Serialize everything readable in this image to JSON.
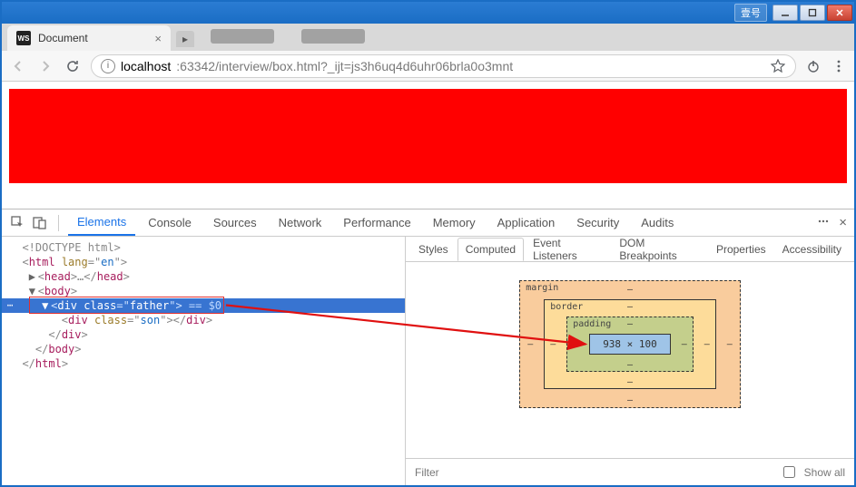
{
  "window": {
    "lang_badge": "壹号"
  },
  "tab": {
    "title": "Document",
    "favicon": "WS"
  },
  "address": {
    "host": "localhost",
    "path": ":63342/interview/box.html?_ijt=js3h6uq4d6uhr06brla0o3mnt"
  },
  "devtools": {
    "tabs": [
      "Elements",
      "Console",
      "Sources",
      "Network",
      "Performance",
      "Memory",
      "Application",
      "Security",
      "Audits"
    ],
    "active_tab": 0,
    "dom": {
      "l0": "<!DOCTYPE html>",
      "l1_open": "<",
      "l1_tag": "html",
      "l1_attr": " lang",
      "l1_eq": "=\"",
      "l1_val": "en",
      "l1_close": "\">",
      "l2_open": "<",
      "l2_tag": "head",
      "l2_mid": ">…</",
      "l2_tag2": "head",
      "l2_end": ">",
      "l3_open": "<",
      "l3_tag": "body",
      "l3_end": ">",
      "sel_open": "<",
      "sel_tag": "div",
      "sel_attr": " class",
      "sel_eq": "=\"",
      "sel_val": "father",
      "sel_close": "\">",
      "sel_suffix": " == $0",
      "l5_open": "<",
      "l5_tag": "div",
      "l5_attr": " class",
      "l5_eq": "=\"",
      "l5_val": "son",
      "l5_close": "\"></",
      "l5_tag2": "div",
      "l5_end": ">",
      "l6": "</",
      "l6_tag": "div",
      "l6_end": ">",
      "l7": "</",
      "l7_tag": "body",
      "l7_end": ">",
      "l8": "</",
      "l8_tag": "html",
      "l8_end": ">"
    },
    "right_tabs": [
      "Styles",
      "Computed",
      "Event Listeners",
      "DOM Breakpoints",
      "Properties",
      "Accessibility"
    ],
    "right_active": 1,
    "box_model": {
      "margin_label": "margin",
      "border_label": "border",
      "padding_label": "padding",
      "content": "938 × 100",
      "dash": "–"
    },
    "filter_placeholder": "Filter",
    "show_all": "Show all"
  }
}
